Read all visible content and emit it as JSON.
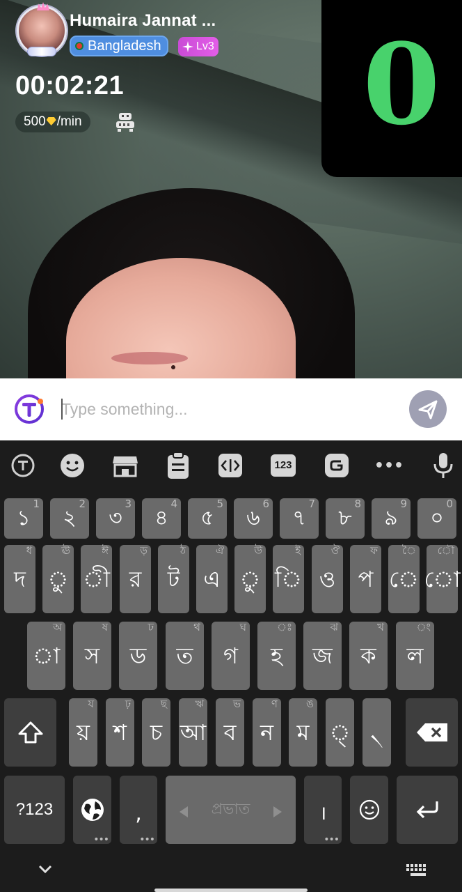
{
  "caller": {
    "name": "Humaira Jannat ...",
    "country": "Bangladesh",
    "level": "Lv3"
  },
  "call": {
    "timer": "00:02:21",
    "rate_amount": "500",
    "rate_unit": "/min"
  },
  "pip": {
    "digit": "0",
    "color": "#48d26c"
  },
  "message_bar": {
    "placeholder": "Type something..."
  },
  "keyboard": {
    "toolbar_icons": [
      "translate-icon",
      "emoji-icon",
      "store-icon",
      "clipboard-icon",
      "text-edit-icon",
      "numpad-icon",
      "gif-icon",
      "more-icon",
      "mic-icon"
    ],
    "toolbar_numpad_label": "123",
    "toolbar_more_label": "•••",
    "number_row": [
      {
        "main": "১",
        "alt": "1"
      },
      {
        "main": "২",
        "alt": "2"
      },
      {
        "main": "৩",
        "alt": "3"
      },
      {
        "main": "৪",
        "alt": "4"
      },
      {
        "main": "৫",
        "alt": "5"
      },
      {
        "main": "৬",
        "alt": "6"
      },
      {
        "main": "৭",
        "alt": "7"
      },
      {
        "main": "৮",
        "alt": "8"
      },
      {
        "main": "৯",
        "alt": "9"
      },
      {
        "main": "০",
        "alt": "0"
      }
    ],
    "row1": [
      {
        "main": "দ",
        "alt": "ধ"
      },
      {
        "main": "ু",
        "alt": "ঊ"
      },
      {
        "main": "ী",
        "alt": "ঈ"
      },
      {
        "main": "র",
        "alt": "ড়"
      },
      {
        "main": "ট",
        "alt": "ঠ"
      },
      {
        "main": "এ",
        "alt": "ঐ"
      },
      {
        "main": "ু",
        "alt": "উ"
      },
      {
        "main": "ি",
        "alt": "ই"
      },
      {
        "main": "ও",
        "alt": "ঔ"
      },
      {
        "main": "প",
        "alt": "ফ"
      },
      {
        "main": "ে",
        "alt": "ৈ"
      },
      {
        "main": "ো",
        "alt": "ৌ"
      }
    ],
    "row2": [
      {
        "main": "া",
        "alt": "অ"
      },
      {
        "main": "স",
        "alt": "ষ"
      },
      {
        "main": "ড",
        "alt": "ঢ"
      },
      {
        "main": "ত",
        "alt": "থ"
      },
      {
        "main": "গ",
        "alt": "ঘ"
      },
      {
        "main": "হ",
        "alt": "ঃ"
      },
      {
        "main": "জ",
        "alt": "ঝ"
      },
      {
        "main": "ক",
        "alt": "খ"
      },
      {
        "main": "ল",
        "alt": "ং"
      }
    ],
    "row3": [
      {
        "main": "য়",
        "alt": "য"
      },
      {
        "main": "শ",
        "alt": "ঢ়"
      },
      {
        "main": "চ",
        "alt": "ছ"
      },
      {
        "main": "আ",
        "alt": "ঋ"
      },
      {
        "main": "ব",
        "alt": "ভ"
      },
      {
        "main": "ন",
        "alt": "ণ"
      },
      {
        "main": "ম",
        "alt": "ঙ"
      },
      {
        "main": "্",
        "alt": ""
      },
      {
        "main": "৲",
        "alt": ""
      }
    ],
    "symbols_label": "?123",
    "comma_label": ",",
    "space_label": "প্রভাত",
    "danda_label": "।"
  }
}
